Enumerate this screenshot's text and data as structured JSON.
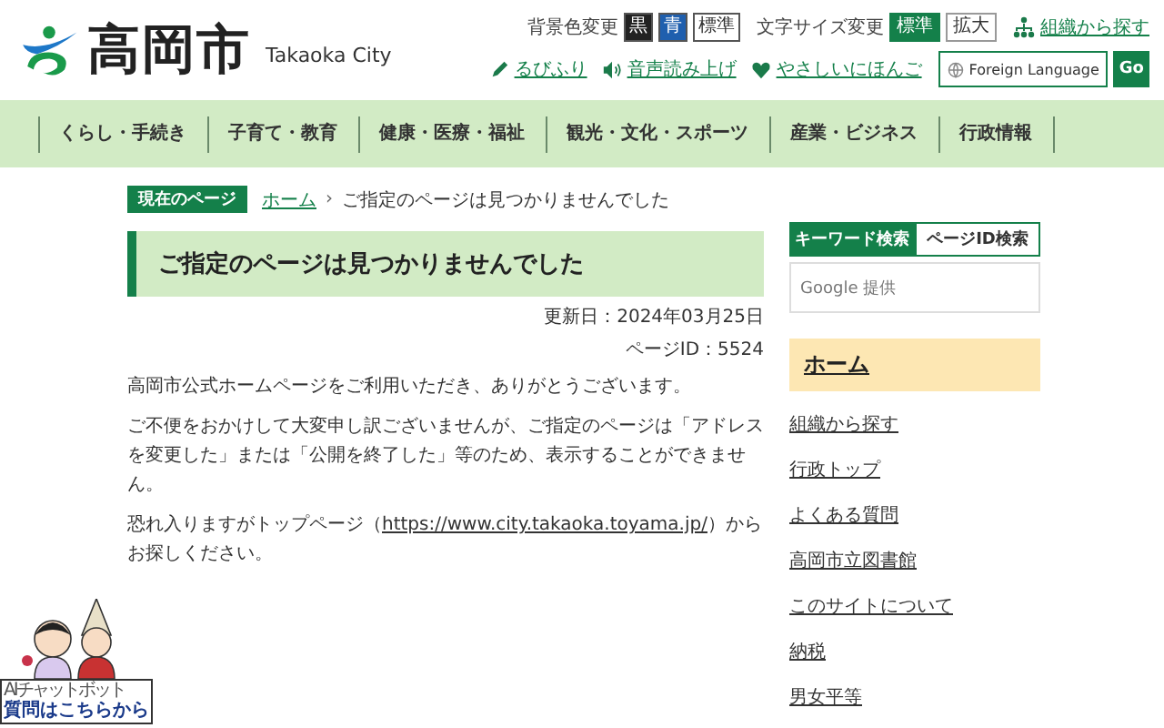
{
  "header": {
    "site_name": "高岡市",
    "site_name_en": "Takaoka City",
    "color_change": {
      "label": "背景色変更",
      "options": [
        {
          "label": "黒",
          "color": "#222222"
        },
        {
          "label": "青",
          "color": "#1f5fae"
        },
        {
          "label": "標準",
          "color": "#ffffff"
        }
      ]
    },
    "text_size": {
      "label": "文字サイズ変更",
      "options": [
        {
          "label": "標準",
          "selected": true
        },
        {
          "label": "拡大",
          "selected": false
        }
      ]
    },
    "org_search": "組織から探す",
    "tools": [
      {
        "kind": "ruby",
        "label": "るびふり"
      },
      {
        "kind": "voice",
        "label": "音声読み上げ"
      },
      {
        "kind": "easy",
        "label": "やさしいにほんご"
      }
    ],
    "language": {
      "label": "Foreign Language",
      "button": "Go"
    }
  },
  "nav": [
    "くらし・手続き",
    "子育て・教育",
    "健康・医療・福祉",
    "観光・文化・スポーツ",
    "産業・ビジネス",
    "行政情報"
  ],
  "breadcrumb": {
    "badge": "現在のページ",
    "separator": "›",
    "items": [
      {
        "label": "ホーム",
        "link": true
      },
      {
        "label": "ご指定のページは見つかりませんでした",
        "link": false
      }
    ]
  },
  "main": {
    "title": "ご指定のページは見つかりませんでした",
    "updated": "更新日：2024年03月25日",
    "page_id": "ページID：5524",
    "paragraphs": [
      "高岡市公式ホームページをご利用いただき、ありがとうございます。",
      "ご不便をおかけして大変申し訳ございませんが、ご指定のページは「アドレスを変更した」または「公開を終了した」等のため、表示することができません。"
    ],
    "top_link": {
      "before": "恐れ入りますがトップページ（",
      "url": "https://www.city.takaoka.toyama.jp/",
      "after": "）からお探しください。"
    }
  },
  "sidebar": {
    "search_tabs": [
      {
        "label": "キーワード検索",
        "selected": true
      },
      {
        "label": "ページID検索",
        "selected": false
      }
    ],
    "search_brand": "Google 提供",
    "home": "ホーム",
    "links": [
      "組織から探す",
      "行政トップ",
      "よくある質問",
      "高岡市立図書館",
      "このサイトについて",
      "納税",
      "男女平等"
    ]
  },
  "chatbot": {
    "caption": "AIチャットボット",
    "label": "質問はこちらから"
  }
}
